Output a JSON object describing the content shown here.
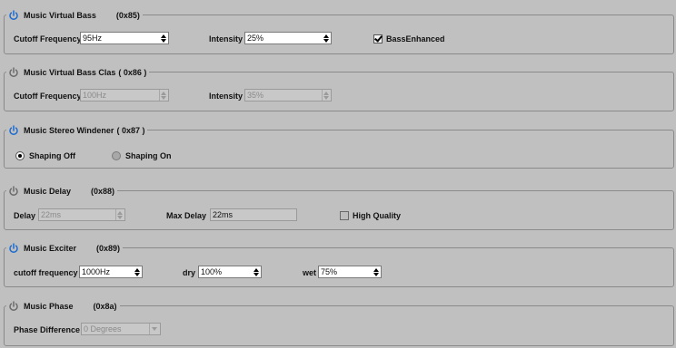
{
  "colors": {
    "background": "#c0c0c0",
    "power_on": "#1a6ad0",
    "power_off": "#6a6a6a"
  },
  "icons": {
    "power": "power-icon"
  },
  "vbass": {
    "title": "Music Virtual Bass",
    "code": "(0x85)",
    "power_on": true,
    "cutoff_label": "Cutoff Frequency",
    "cutoff_value": "95Hz",
    "intensity_label": "Intensity",
    "intensity_value": "25%",
    "bass_enhanced_label": "BassEnhanced",
    "bass_enhanced_checked": true
  },
  "vbass_classic": {
    "title": "Music Virtual Bass Clas",
    "code": "( 0x86 )",
    "power_on": false,
    "cutoff_label": "Cutoff Frequency",
    "cutoff_value": "100Hz",
    "intensity_label": "Intensity",
    "intensity_value": "35%"
  },
  "stereo": {
    "title": "Music Stereo Windener",
    "code": "( 0x87 )",
    "power_on": true,
    "options": [
      {
        "label": "Shaping Off",
        "selected": true
      },
      {
        "label": "Shaping On",
        "selected": false
      }
    ]
  },
  "delay": {
    "title": "Music Delay",
    "code": "(0x88)",
    "power_on": false,
    "delay_label": "Delay",
    "delay_value": "22ms",
    "max_delay_label": "Max Delay",
    "max_delay_value": "22ms",
    "high_quality_label": "High Quality",
    "high_quality_checked": false
  },
  "exciter": {
    "title": "Music Exciter",
    "code": "(0x89)",
    "power_on": true,
    "cutoff_label": "cutoff frequency",
    "cutoff_value": "1000Hz",
    "dry_label": "dry",
    "dry_value": "100%",
    "wet_label": "wet",
    "wet_value": "75%"
  },
  "phase": {
    "title": "Music Phase",
    "code": "(0x8a)",
    "power_on": false,
    "phase_label": "Phase Difference",
    "phase_value": "0 Degrees"
  }
}
